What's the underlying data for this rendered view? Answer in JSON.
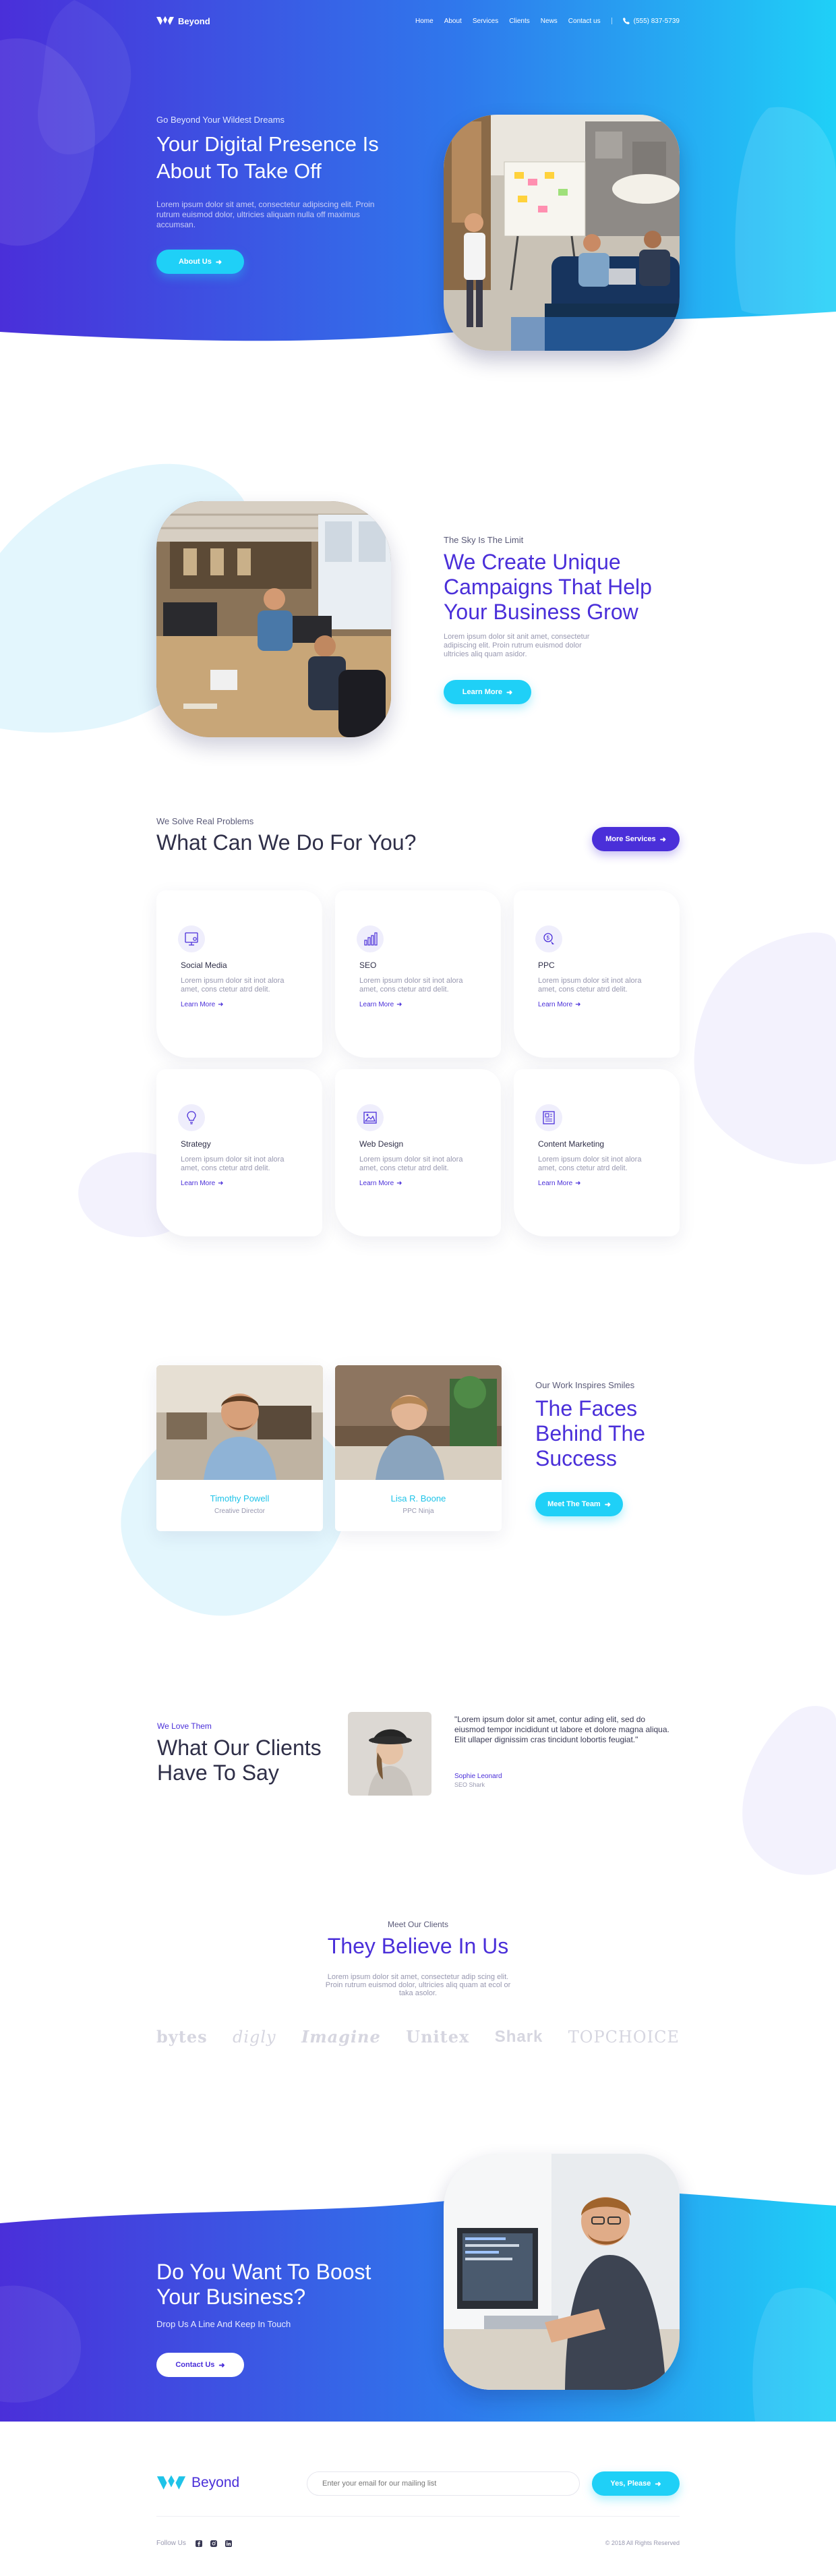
{
  "brand": {
    "name": "Beyond"
  },
  "nav": {
    "links": [
      "Home",
      "About",
      "Services",
      "Clients",
      "News",
      "Contact us"
    ],
    "phone": "(555) 837-5739"
  },
  "hero": {
    "eyebrow": "Go Beyond Your Wildest Dreams",
    "title": "Your Digital Presence Is About To Take Off",
    "text": "Lorem ipsum dolor sit amet, consectetur adipiscing elit. Proin rutrum euismod dolor, ultricies aliquam nulla off maximus accumsan.",
    "button": "About Us"
  },
  "about": {
    "eyebrow": "The Sky Is The Limit",
    "title": "We Create Unique Campaigns That Help Your Business Grow",
    "text": "Lorem ipsum dolor sit anit amet, consectetur adipiscing elit. Proin rutrum euismod dolor ultricies aliq quam asidor.",
    "button": "Learn More"
  },
  "services": {
    "eyebrow": "We Solve Real Problems",
    "title": "What Can We Do For You?",
    "button": "More Services",
    "items": [
      {
        "title": "Social Media",
        "text": "Lorem ipsum dolor sit inot alora amet, cons ctetur atrd delit.",
        "link": "Learn More",
        "icon": "social-media-icon"
      },
      {
        "title": "SEO",
        "text": "Lorem ipsum dolor sit inot alora amet, cons ctetur atrd delit.",
        "link": "Learn More",
        "icon": "seo-chart-icon"
      },
      {
        "title": "PPC",
        "text": "Lorem ipsum dolor sit inot alora amet, cons ctetur atrd delit.",
        "link": "Learn More",
        "icon": "ppc-click-icon"
      },
      {
        "title": "Strategy",
        "text": "Lorem ipsum dolor sit inot alora amet, cons ctetur atrd delit.",
        "link": "Learn More",
        "icon": "lightbulb-icon"
      },
      {
        "title": "Web Design",
        "text": "Lorem ipsum dolor sit inot alora amet, cons ctetur atrd delit.",
        "link": "Learn More",
        "icon": "image-frame-icon"
      },
      {
        "title": "Content Marketing",
        "text": "Lorem ipsum dolor sit inot alora amet, cons ctetur atrd delit.",
        "link": "Learn More",
        "icon": "document-icon"
      }
    ]
  },
  "team": {
    "eyebrow": "Our Work Inspires Smiles",
    "title": "The Faces Behind The Success",
    "button": "Meet The Team",
    "members": [
      {
        "name": "Timothy Powell",
        "role": "Creative Director"
      },
      {
        "name": "Lisa R. Boone",
        "role": "PPC Ninja"
      }
    ]
  },
  "testimonial": {
    "eyebrow": "We Love Them",
    "title": "What Our Clients Have To Say",
    "quote": "\"Lorem ipsum dolor sit amet, contur ading elit, sed do eiusmod tempor incididunt ut labore et dolore magna aliqua. Elit ullaper dignissim cras tincidunt lobortis feugiat.\"",
    "name": "Sophie Leonard",
    "role": "SEO Shark"
  },
  "clients": {
    "eyebrow": "Meet Our Clients",
    "title": "They Believe In Us",
    "text": "Lorem ipsum dolor sit amet, consectetur adip scing elit. Proin rutrum euismod dolor, ultricies aliq quam at ecol or taka asolor.",
    "logos": [
      "bytes",
      "digly",
      "Imagine",
      "Unitex",
      "Shark",
      "TOPCHOICE"
    ]
  },
  "cta": {
    "title": "Do You Want To Boost Your Business?",
    "subtitle": "Drop Us A Line And Keep In Touch",
    "button": "Contact Us"
  },
  "footer": {
    "brand": "Beyond",
    "email_placeholder": "Enter your email for our mailing list",
    "button": "Yes, Please",
    "follow": "Follow Us",
    "copyright": "© 2018 All Rights Reserved"
  },
  "colors": {
    "primary": "#4a2fd9",
    "accent": "#1fd0f7",
    "text": "#2f2f48",
    "muted": "#9898b0"
  }
}
